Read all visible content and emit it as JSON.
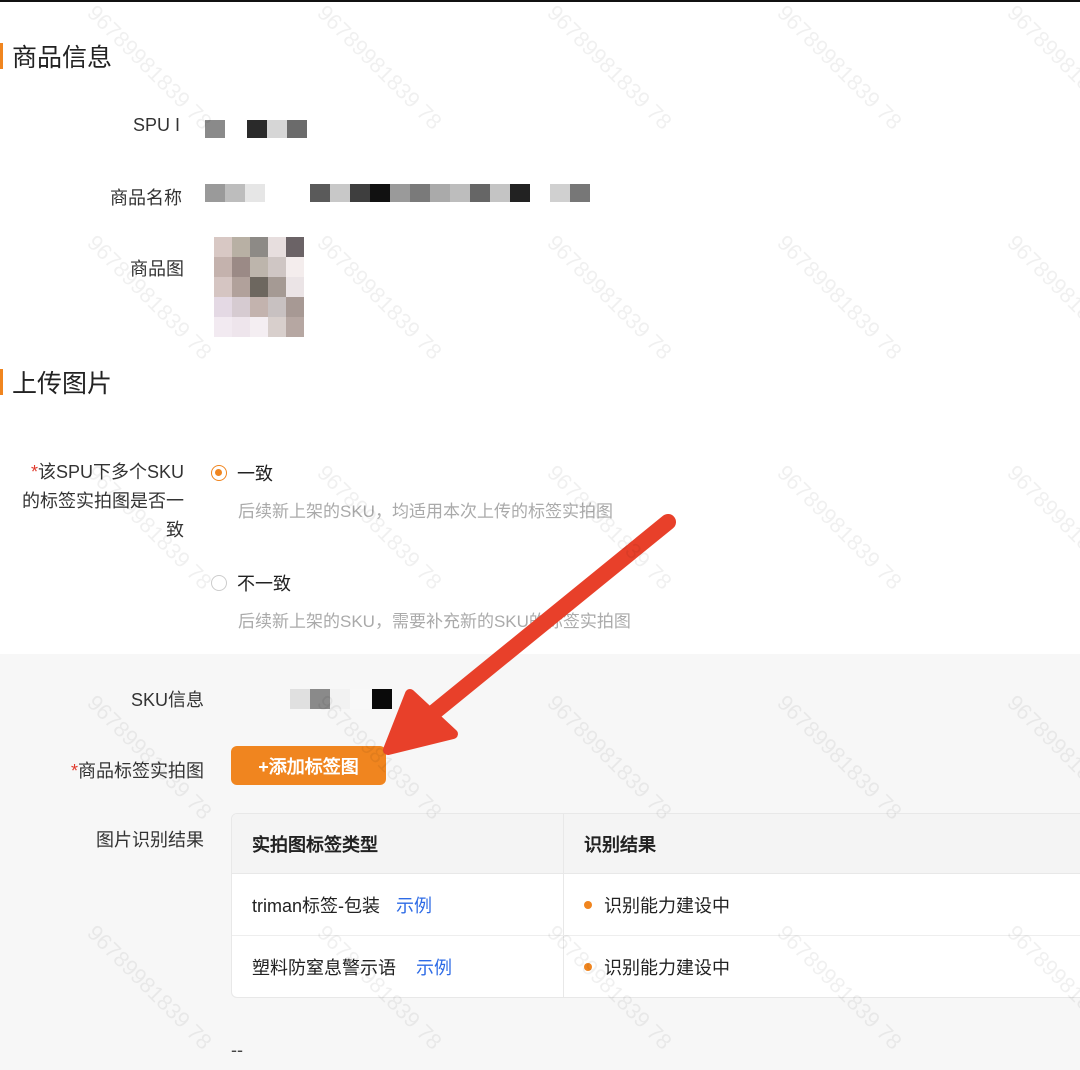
{
  "section_product": {
    "title": "商品信息"
  },
  "fields": {
    "spu_label": "SPU I",
    "name_label": "商品名称",
    "image_label": "商品图"
  },
  "section_upload": {
    "title": "上传图片"
  },
  "question": {
    "line1": "该SPU下多个SKU",
    "line2": "的标签实拍图是否一",
    "line3": "致",
    "required_mark": "*"
  },
  "options": [
    {
      "label": "一致",
      "hint": "后续新上架的SKU，均适用本次上传的标签实拍图",
      "checked": true
    },
    {
      "label": "不一致",
      "hint": "后续新上架的SKU，需要补充新的SKU的标签实拍图",
      "checked": false
    }
  ],
  "sku": {
    "info_label": "SKU信息",
    "photo_label": "商品标签实拍图",
    "add_button": "+添加标签图",
    "result_label": "图片识别结果"
  },
  "table": {
    "headers": [
      "实拍图标签类型",
      "识别结果"
    ],
    "rows": [
      {
        "type": "triman标签-包装",
        "link": "示例",
        "result": "识别能力建设中"
      },
      {
        "type": "塑料防窒息警示语",
        "link": "示例",
        "result": "识别能力建设中"
      }
    ]
  },
  "footer": {
    "dashes": "--"
  },
  "watermark": "96789981839 78",
  "colors": {
    "accent": "#f0851f",
    "link": "#2e6be6",
    "arrow": "#e8402a"
  }
}
